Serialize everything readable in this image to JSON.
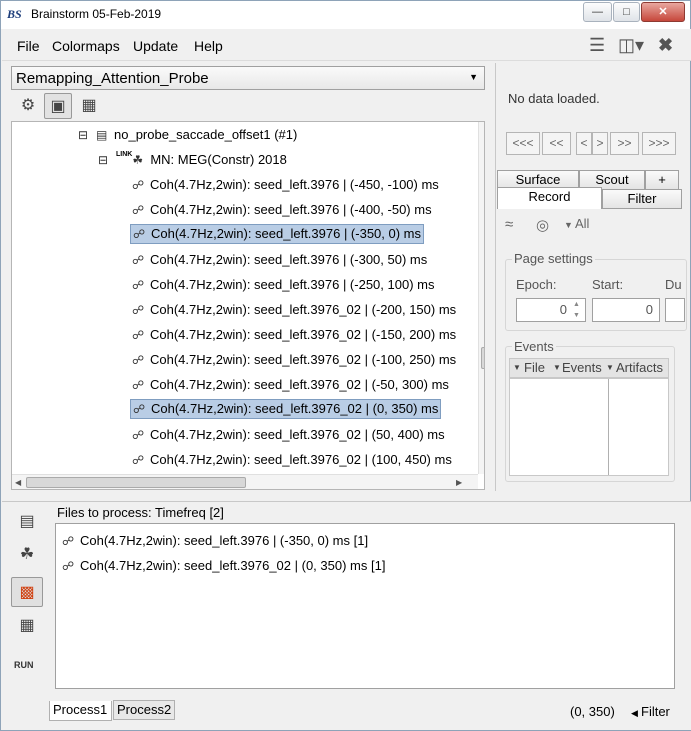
{
  "window": {
    "logo": "BS",
    "title": "Brainstorm 05-Feb-2019"
  },
  "menubar": {
    "file": "File",
    "colormaps": "Colormaps",
    "update": "Update",
    "help": "Help"
  },
  "protocol": {
    "selected": "Remapping_Attention_Probe"
  },
  "tree": {
    "folder": "no_probe_saccade_offset1 (#1)",
    "link_tag": "LINK",
    "source": "MN: MEG(Constr) 2018",
    "items": [
      "Coh(4.7Hz,2win): seed_left.3976 | (-450, -100) ms",
      "Coh(4.7Hz,2win): seed_left.3976 | (-400, -50) ms",
      "Coh(4.7Hz,2win): seed_left.3976 | (-350, 0) ms",
      "Coh(4.7Hz,2win): seed_left.3976 | (-300, 50) ms",
      "Coh(4.7Hz,2win): seed_left.3976 | (-250, 100) ms",
      "Coh(4.7Hz,2win): seed_left.3976_02 | (-200, 150) ms",
      "Coh(4.7Hz,2win): seed_left.3976_02 | (-150, 200) ms",
      "Coh(4.7Hz,2win): seed_left.3976_02 | (-100, 250) ms",
      "Coh(4.7Hz,2win): seed_left.3976_02 | (-50, 300) ms",
      "Coh(4.7Hz,2win): seed_left.3976_02 | (0, 350) ms",
      "Coh(4.7Hz,2win): seed_left.3976_02 | (50, 400) ms",
      "Coh(4.7Hz,2win): seed_left.3976_02 | (100, 450) ms"
    ]
  },
  "right_panel": {
    "no_data": "No data loaded.",
    "nav": [
      "<<<",
      "<<",
      "<",
      ">",
      ">>",
      ">>>"
    ],
    "tabs_top": [
      "Surface",
      "Scout",
      "+"
    ],
    "tabs": [
      "Record",
      "Filter"
    ],
    "all_label": "All",
    "page_settings": "Page settings",
    "epoch_label": "Epoch:",
    "start_label": "Start:",
    "duration_label": "Du",
    "epoch_value": "0",
    "start_value": "0",
    "events_title": "Events",
    "events_menus": [
      "File",
      "Events",
      "Artifacts"
    ]
  },
  "process": {
    "title": "Files to process: Timefreq [2]",
    "files": [
      "Coh(4.7Hz,2win): seed_left.3976 | (-350, 0) ms [1]",
      "Coh(4.7Hz,2win): seed_left.3976_02 | (0, 350) ms [1]"
    ],
    "tabs": [
      "Process1",
      "Process2"
    ],
    "run": "RUN",
    "time_window": "(0, 350)",
    "filter": "Filter"
  }
}
